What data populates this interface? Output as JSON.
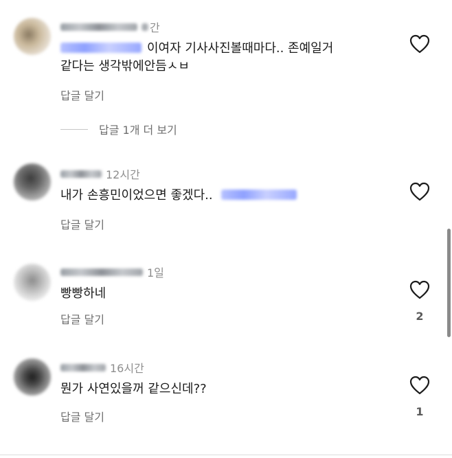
{
  "comments": [
    {
      "time_fragment": "간",
      "text": "이여자 기사사진볼때마다.. 존예일거\n같다는 생각밖에안듬ㅅㅂ",
      "reply_label": "답글 달기",
      "likes": ""
    },
    {
      "time": "12시간",
      "text": "내가 손흥민이었으면 좋겠다..",
      "reply_label": "답글 달기",
      "likes": ""
    },
    {
      "time": "1일",
      "text": "빵빵하네",
      "reply_label": "답글 달기",
      "likes": "2"
    },
    {
      "time": "16시간",
      "text": "뭔가 사연있을꺼 같으신데??",
      "reply_label": "답글 달기",
      "likes": "1"
    }
  ],
  "view_more_replies": "답글 1개 더 보기",
  "icons": {
    "like": "heart-outline-icon"
  },
  "colors": {
    "text": "#1b1b1b",
    "secondary": "#8e8e8e",
    "heart_stroke": "#1b1b1b",
    "mention_blur": "#98a8ff"
  }
}
